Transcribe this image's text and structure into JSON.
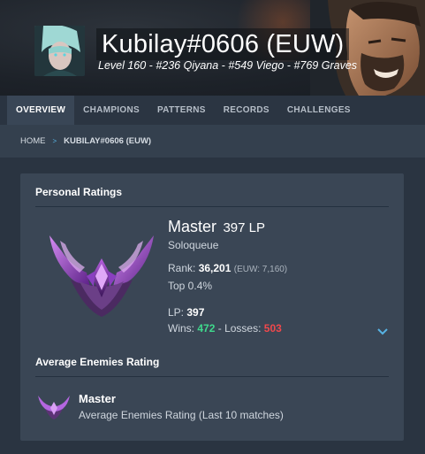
{
  "profile": {
    "name": "Kubilay#0606 (EUW)",
    "subline": "Level 160 - #236 Qiyana - #549 Viego - #769 Graves"
  },
  "tabs": [
    {
      "label": "OVERVIEW",
      "active": true
    },
    {
      "label": "CHAMPIONS",
      "active": false
    },
    {
      "label": "PATTERNS",
      "active": false
    },
    {
      "label": "RECORDS",
      "active": false
    },
    {
      "label": "CHALLENGES",
      "active": false
    }
  ],
  "breadcrumb": {
    "home": "HOME",
    "separator": ">",
    "current": "KUBILAY#0606 (EUW)"
  },
  "personal_ratings": {
    "title": "Personal Ratings",
    "tier": "Master",
    "lp_label": "397 LP",
    "queue": "Soloqueue",
    "rank_label": "Rank:",
    "rank_value": "36,201",
    "rank_region": "(EUW: 7,160)",
    "top": "Top 0.4%",
    "lp_prefix": "LP:",
    "lp_value": "397",
    "wins_label": "Wins:",
    "wins": "472",
    "dash": "-",
    "losses_label": "Losses:",
    "losses": "503"
  },
  "average_enemies": {
    "title": "Average Enemies Rating",
    "tier": "Master",
    "description": "Average Enemies Rating (Last 10 matches)"
  },
  "colors": {
    "win": "#3fd98c",
    "loss": "#f0484c",
    "accent": "#57b3e4",
    "emblem": "#8a3fc0"
  },
  "icons": {
    "profile_avatar": "champion-portrait-icon",
    "tier_emblem": "master-emblem-icon",
    "expand": "chevron-down-icon"
  }
}
